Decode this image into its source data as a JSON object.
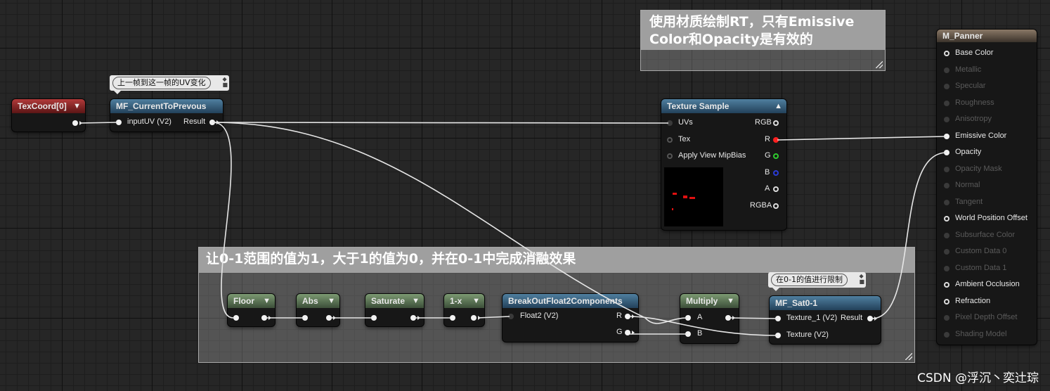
{
  "comments": {
    "top": {
      "title": "使用材质绘制RT，只有Emissive Color和Opacity是有效的"
    },
    "bottom": {
      "title": "让0-1范围的值为1，大于1的值为0，并在0-1中完成消融效果"
    }
  },
  "bubbles": {
    "current_to_prev": "上一帧到这一帧的UV变化",
    "sat": "在0-1的值进行限制"
  },
  "nodes": {
    "texcoord": {
      "title": "TexCoord[0]"
    },
    "current_to_prev": {
      "title": "MF_CurrentToPrevous",
      "in": "inputUV (V2)",
      "out": "Result"
    },
    "texture_sample": {
      "title": "Texture Sample",
      "inputs": [
        "UVs",
        "Tex",
        "Apply View MipBias"
      ],
      "outputs": [
        "RGB",
        "R",
        "G",
        "B",
        "A",
        "RGBA"
      ]
    },
    "floor": {
      "title": "Floor"
    },
    "abs": {
      "title": "Abs"
    },
    "saturate": {
      "title": "Saturate"
    },
    "one_minus": {
      "title": "1-x"
    },
    "breakout": {
      "title": "BreakOutFloat2Components",
      "in": "Float2 (V2)",
      "out_r": "R",
      "out_g": "G"
    },
    "multiply": {
      "title": "Multiply",
      "in_a": "A",
      "in_b": "B"
    },
    "sat": {
      "title": "MF_Sat0-1",
      "in1": "Texture_1 (V2)",
      "out": "Result",
      "in2": "Texture (V2)"
    },
    "panner": {
      "title": "M_Panner",
      "pins": [
        {
          "label": "Base Color",
          "state": "active"
        },
        {
          "label": "Metallic",
          "state": "disabled"
        },
        {
          "label": "Specular",
          "state": "disabled"
        },
        {
          "label": "Roughness",
          "state": "disabled"
        },
        {
          "label": "Anisotropy",
          "state": "disabled"
        },
        {
          "label": "Emissive Color",
          "state": "connected"
        },
        {
          "label": "Opacity",
          "state": "connected"
        },
        {
          "label": "Opacity Mask",
          "state": "disabled"
        },
        {
          "label": "Normal",
          "state": "disabled"
        },
        {
          "label": "Tangent",
          "state": "disabled"
        },
        {
          "label": "World Position Offset",
          "state": "active"
        },
        {
          "label": "Subsurface Color",
          "state": "disabled"
        },
        {
          "label": "Custom Data 0",
          "state": "disabled"
        },
        {
          "label": "Custom Data 1",
          "state": "disabled"
        },
        {
          "label": "Ambient Occlusion",
          "state": "active"
        },
        {
          "label": "Refraction",
          "state": "active"
        },
        {
          "label": "Pixel Depth Offset",
          "state": "disabled"
        },
        {
          "label": "Shading Model",
          "state": "disabled"
        }
      ]
    }
  },
  "colors": {
    "wire": "#e8e8e8",
    "r_pin": "#ff2020",
    "g_pin": "#2ecc2e",
    "b_pin": "#2a3bd8"
  },
  "watermark": "CSDN @浮沉丶奕辻琮"
}
